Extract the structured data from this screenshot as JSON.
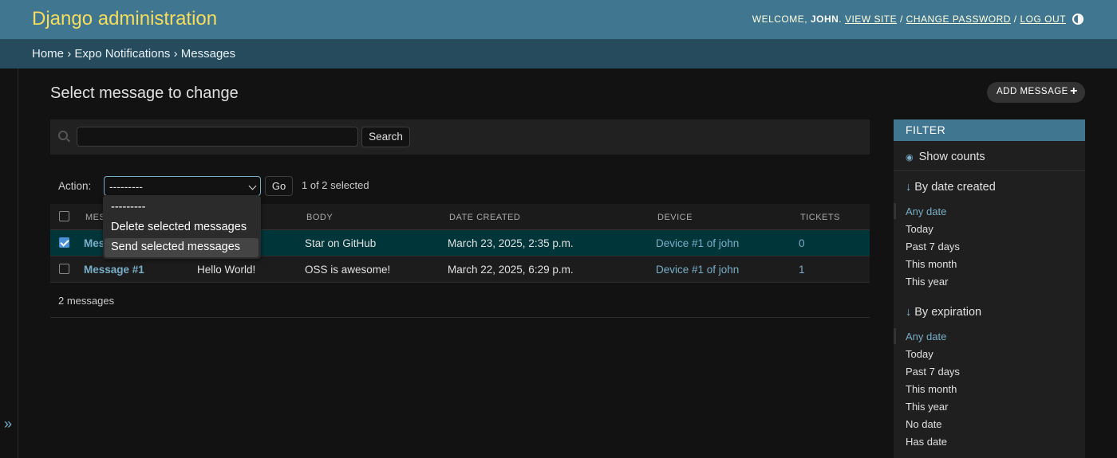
{
  "header": {
    "branding": "Django administration",
    "welcome": "Welcome,",
    "user": "john",
    "view_site": "View site",
    "change_password": "Change password",
    "log_out": "Log out"
  },
  "breadcrumbs": {
    "home": "Home",
    "app": "Expo Notifications",
    "current": "Messages",
    "sep": "›"
  },
  "page": {
    "title": "Select message to change",
    "add_label": "ADD MESSAGE",
    "add_icon": "+"
  },
  "search": {
    "value": "",
    "placeholder": "",
    "button": "Search"
  },
  "actions": {
    "label": "Action:",
    "selected": "---------",
    "options": [
      "---------",
      "Delete selected messages",
      "Send selected messages"
    ],
    "go": "Go",
    "counter": "1 of 2 selected"
  },
  "table": {
    "headers": [
      "MES",
      "BODY",
      "DATE CREATED",
      "DEVICE",
      "TICKETS"
    ],
    "rows": [
      {
        "message": "Mess",
        "title": "",
        "body": "Star on GitHub",
        "date": "March 23, 2025, 2:35 p.m.",
        "device": "Device #1 of john",
        "tickets": "0",
        "checked": true
      },
      {
        "message": "Message #1",
        "title": "Hello World!",
        "body": "OSS is awesome!",
        "date": "March 22, 2025, 6:29 p.m.",
        "device": "Device #1 of john",
        "tickets": "1",
        "checked": false
      }
    ]
  },
  "paginator": "2 messages",
  "filter": {
    "title": "FILTER",
    "show_counts": "Show counts",
    "sections": [
      {
        "title": "By date created",
        "items": [
          "Any date",
          "Today",
          "Past 7 days",
          "This month",
          "This year"
        ]
      },
      {
        "title": "By expiration",
        "items": [
          "Any date",
          "Today",
          "Past 7 days",
          "This month",
          "This year",
          "No date",
          "Has date"
        ]
      }
    ]
  },
  "colors": {
    "header": "#417690",
    "breadcrumbs": "#264b5d",
    "accent_link": "#79aec8",
    "branding": "#f5dd5d",
    "selected_row": "#00363a"
  },
  "icons": {
    "search": "search-icon",
    "theme": "theme-toggle-icon",
    "eye": "eye-icon",
    "arrow": "arrow-down-icon",
    "nav": "chevron-double-right-icon"
  }
}
